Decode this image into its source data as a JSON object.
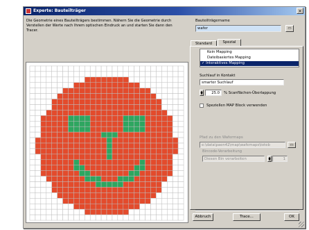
{
  "window": {
    "title": "Experte: Bauteilträger",
    "close_glyph": "×"
  },
  "description": "Die Geometrie eines Bauteilträgers bestimmen. Nähern Sie die Geometrie durch Verstellen der Werte nach Ihrem optischen Eindruck an und starten Sie dann den Tracer.",
  "name_field": {
    "label": "Bauteilträgername",
    "value": "wafer"
  },
  "tabs": [
    {
      "label": "Standard",
      "active": false
    },
    {
      "label": "Spezial",
      "active": true
    }
  ],
  "mapping_list": {
    "items": [
      {
        "label": "Kein Mapping",
        "selected": false
      },
      {
        "label": "Dateibasiertes Mapping",
        "selected": false
      },
      {
        "label": "✓ Interaktives Mapping",
        "selected": true
      }
    ]
  },
  "search": {
    "label": "Suchlauf in Kontakt",
    "value": "smarter Suchlauf"
  },
  "overlap": {
    "value": "25.0",
    "label": "% Scanflächen-Überlappung"
  },
  "map_block": {
    "label": "Speziellen MAP Block verwenden",
    "checked": false
  },
  "wafermap_path": {
    "label": "Pfad zu den Wafermaps",
    "value": "e:\\data\\paen42\\map\\wafemaps\\toteb"
  },
  "bincode": {
    "label": "Bincode-Verarbeitung",
    "value": "Diesen Bin verarbeiten",
    "number": "1"
  },
  "buttons": {
    "cancel": "Abbruch",
    "trace": "Trace...",
    "ok": "OK",
    "browse_glyph": "▭"
  },
  "wafer_grid": {
    "cols": 28,
    "rows": 28,
    "colors": {
      "die": "#e34b2c",
      "feature": "#2ea660",
      "empty": "#ffffff",
      "grid": "#bdbdbd"
    }
  }
}
